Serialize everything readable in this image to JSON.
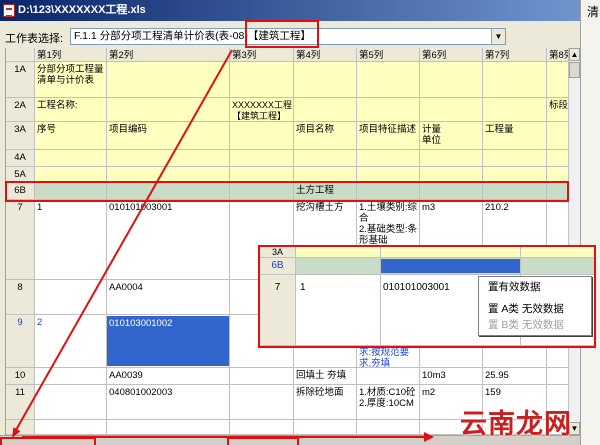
{
  "window": {
    "title": "D:\\123\\XXXXXXX工程.xls",
    "icon": "excel-file-icon"
  },
  "sheet_selector": {
    "label": "工作表选择:",
    "value": "F.1.1 分部分项工程清单计价表(表-08)【建筑工程】",
    "icon": "chevron-down-icon"
  },
  "grid": {
    "columns": [
      "第1列",
      "第2列",
      "第3列",
      "第4列",
      "第5列",
      "第6列",
      "第7列",
      "第8列"
    ],
    "rows": [
      {
        "header": "1A",
        "c1": "分部分项工程量\n清单与计价表"
      },
      {
        "header": "2A",
        "c1": "工程名称:",
        "c3": "XXXXXXX工程\n【建筑工程】",
        "c8": "标段"
      },
      {
        "header": "3A",
        "c1": "序号",
        "c2": "项目编码",
        "c4": "项目名称",
        "c5": "项目特征描述",
        "c6": "计量\n单位",
        "c7": "工程量"
      },
      {
        "header": "4A"
      },
      {
        "header": "5A"
      },
      {
        "header": "6B",
        "c4": "土方工程"
      },
      {
        "header": "7",
        "c1": "1",
        "c2": "010101003001",
        "c4": "挖沟槽土方",
        "c5": "1.土壤类别:综合\n2.基础类型:条形基础\n3.基础长宽:",
        "c6": "m3",
        "c7": "210.2"
      },
      {
        "header": "8",
        "c2": "AA0004"
      },
      {
        "header": "9",
        "c1": "2",
        "c2": "010103001002",
        "c5": "求:按规范要求,夯填"
      },
      {
        "header": "10",
        "c2": "AA0039",
        "c4": "回填土 夯填",
        "c6": "10m3",
        "c7": "25.95"
      },
      {
        "header": "11",
        "c2": "040801002003",
        "c4": "拆除砼地面",
        "c5": "1.材质:C10砼\n2.厚度:10CM",
        "c6": "m2",
        "c7": "159"
      }
    ]
  },
  "inset": {
    "rows": [
      {
        "header": "3A"
      },
      {
        "header": "6B"
      },
      {
        "header": "7",
        "c1": "1",
        "c2": "010101003001"
      }
    ]
  },
  "context_menu": {
    "items": [
      {
        "label": "置有效数据"
      },
      {
        "label": "置 A类 无效数据"
      },
      {
        "label": "置 B类 无效数据",
        "disabled": true
      }
    ]
  },
  "side_panel": {
    "text": "清"
  },
  "watermark": "云南龙网",
  "colors": {
    "yellow_row": "#ffffc0",
    "group_row": "#c8dcc8",
    "selection": "#3366cc",
    "annotation": "#e01010",
    "current_row_text": "#1a3fd8"
  }
}
